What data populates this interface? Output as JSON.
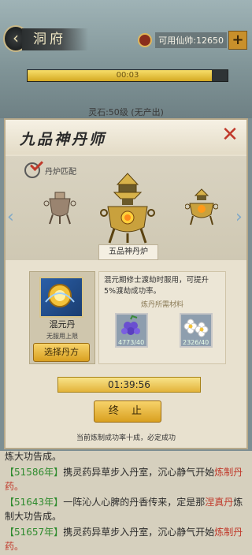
{
  "header": {
    "back_label": "‹",
    "title": "洞府",
    "spirit_label": "可用仙帅:12650",
    "plus_label": "+"
  },
  "progress": {
    "text": "00:03",
    "fill_percent": 92
  },
  "spirit_stone_line": "灵石:50级 (无产出)",
  "panel": {
    "title": "九品神丹师",
    "close_label": "✕",
    "furnace_match_label": "丹炉匹配",
    "furnace_name": "五品神丹炉",
    "dan": {
      "name": "混元丹",
      "limit": "无服用上限",
      "choose_label": "选择丹方"
    },
    "description": "混元期修士渡劫时服用，可提升5%渡劫成功率。",
    "materials_title": "炼丹所需材料",
    "materials": [
      {
        "count": "4773/40",
        "icon": "grape-herb-icon"
      },
      {
        "count": "2326/40",
        "icon": "flower-herb-icon"
      }
    ],
    "timer": "01:39:56",
    "stop_label": "终 止",
    "hint": "当前炼制成功率十成，必定成功"
  },
  "log": {
    "partial_line": "炼大功告成。",
    "lines": [
      {
        "num": "【51586年】",
        "text": "携灵药异草步入丹室，沉心静气开始",
        "red": "炼制丹药。"
      },
      {
        "num": "【51643年】",
        "text": "一阵沁人心脾的丹香传来，定是那",
        "red": "涅真丹",
        "tail": "炼制大功告成。"
      },
      {
        "num": "【51657年】",
        "text": "携灵药异草步入丹室，沉心静气开始",
        "red": "炼制丹药。"
      }
    ]
  }
}
